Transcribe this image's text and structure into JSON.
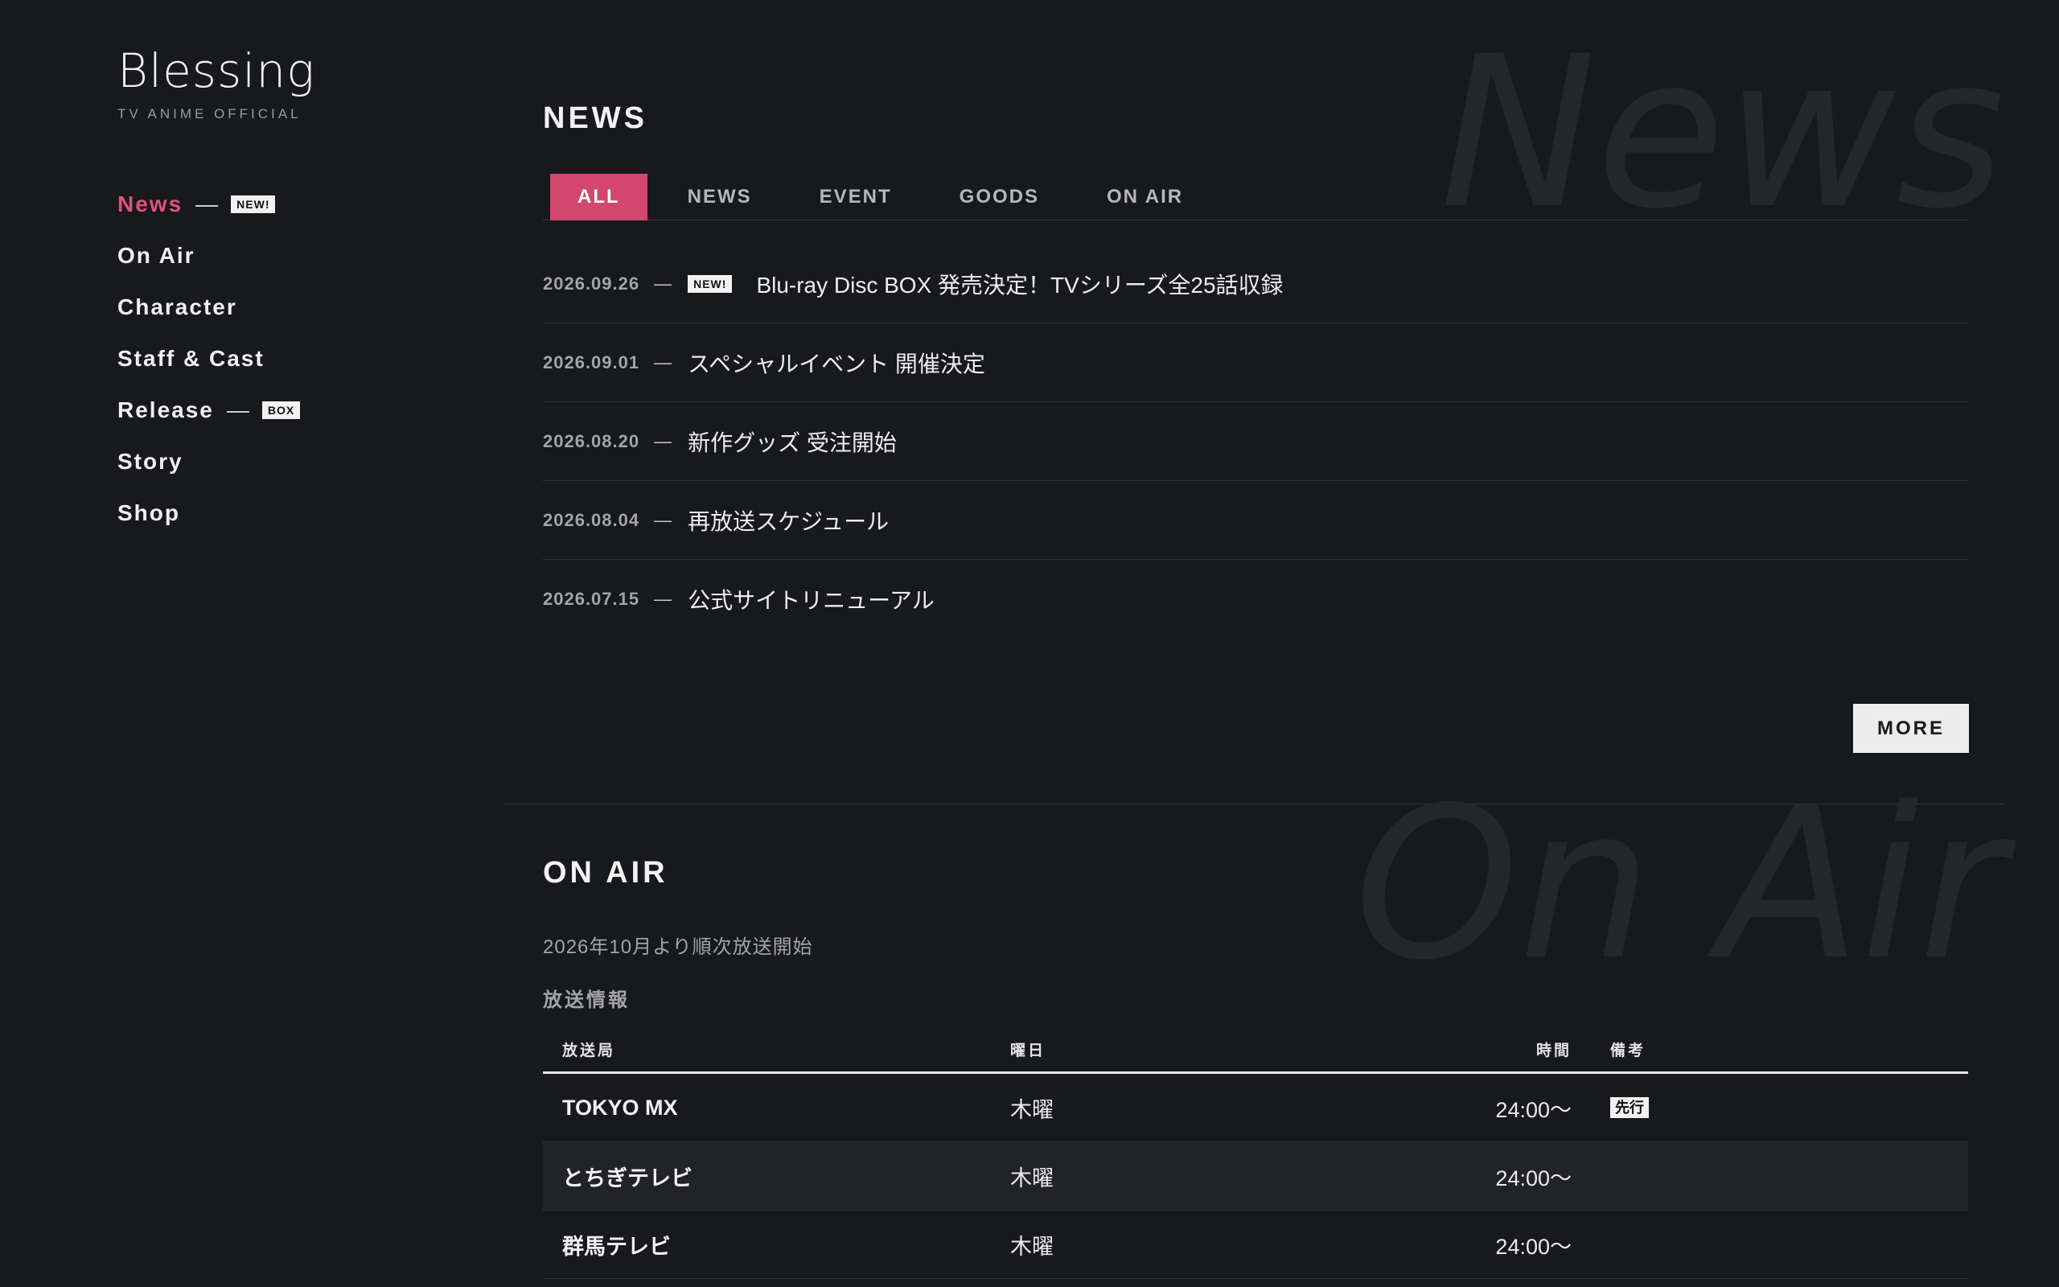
{
  "brand": {
    "title": "Blessing",
    "subtitle": "TV ANIME OFFICIAL"
  },
  "nav": {
    "items": [
      {
        "label": "News",
        "tag": "NEW!"
      },
      {
        "label": "On Air",
        "tag": ""
      },
      {
        "label": "Character",
        "tag": ""
      },
      {
        "label": "Staff & Cast",
        "tag": ""
      },
      {
        "label": "Release",
        "tag": "BOX"
      },
      {
        "label": "Story",
        "tag": ""
      },
      {
        "label": "Shop",
        "tag": ""
      }
    ],
    "dash": "—"
  },
  "news": {
    "bg_word": "News",
    "title": "NEWS",
    "tabs": [
      "ALL",
      "NEWS",
      "EVENT",
      "GOODS",
      "ON AIR"
    ],
    "items": [
      {
        "date": "2026.09.26",
        "tag": "NEW!",
        "title": "Blu-ray Disc BOX 発売決定！TVシリーズ全25話収録"
      },
      {
        "date": "2026.09.01",
        "title": "スペシャルイベント 開催決定"
      },
      {
        "date": "2026.08.20",
        "title": "新作グッズ 受注開始"
      },
      {
        "date": "2026.08.04",
        "title": "再放送スケジュール"
      },
      {
        "date": "2026.07.15",
        "title": "公式サイトリニューアル"
      }
    ],
    "dash": "—",
    "more_label": "MORE"
  },
  "onair": {
    "bg_word": "On Air",
    "title": "ON AIR",
    "lead": "2026年10月より順次放送開始",
    "subtitle": "放送情報",
    "headers": [
      "放送局",
      "曜日",
      "時間",
      "備考"
    ],
    "rows": [
      {
        "station": "TOKYO MX",
        "day": "木曜",
        "time": "24:00〜",
        "note": "先行"
      },
      {
        "station": "とちぎテレビ",
        "day": "木曜",
        "time": "24:00〜",
        "note": ""
      },
      {
        "station": "群馬テレビ",
        "day": "木曜",
        "time": "24:00〜",
        "note": ""
      }
    ]
  },
  "colors": {
    "background": "#18191c",
    "accent": "#d2466f",
    "active_nav": "#e2517b"
  }
}
